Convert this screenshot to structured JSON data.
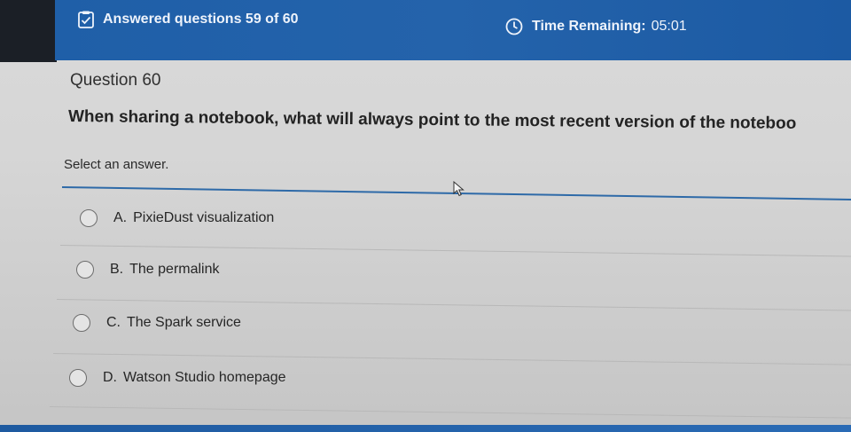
{
  "header": {
    "answered_label": "Answered questions 59 of 60",
    "time_label": "Time Remaining:",
    "time_value": "05:01",
    "colors": {
      "background": "#1f5fa8",
      "text": "#eef3fb"
    }
  },
  "question": {
    "number_label": "Question 60",
    "text": "When sharing a notebook, what will always point to the most recent version of the noteboo",
    "instruction": "Select an answer."
  },
  "options": [
    {
      "letter": "A.",
      "label": "PixieDust visualization"
    },
    {
      "letter": "B.",
      "label": "The permalink"
    },
    {
      "letter": "C.",
      "label": "The Spark service"
    },
    {
      "letter": "D.",
      "label": "Watson Studio homepage"
    }
  ],
  "icons": {
    "answered": "checklist-icon",
    "timer": "clock-icon",
    "pointer": "mouse-cursor-icon",
    "radio": "radio-unselected-icon"
  }
}
